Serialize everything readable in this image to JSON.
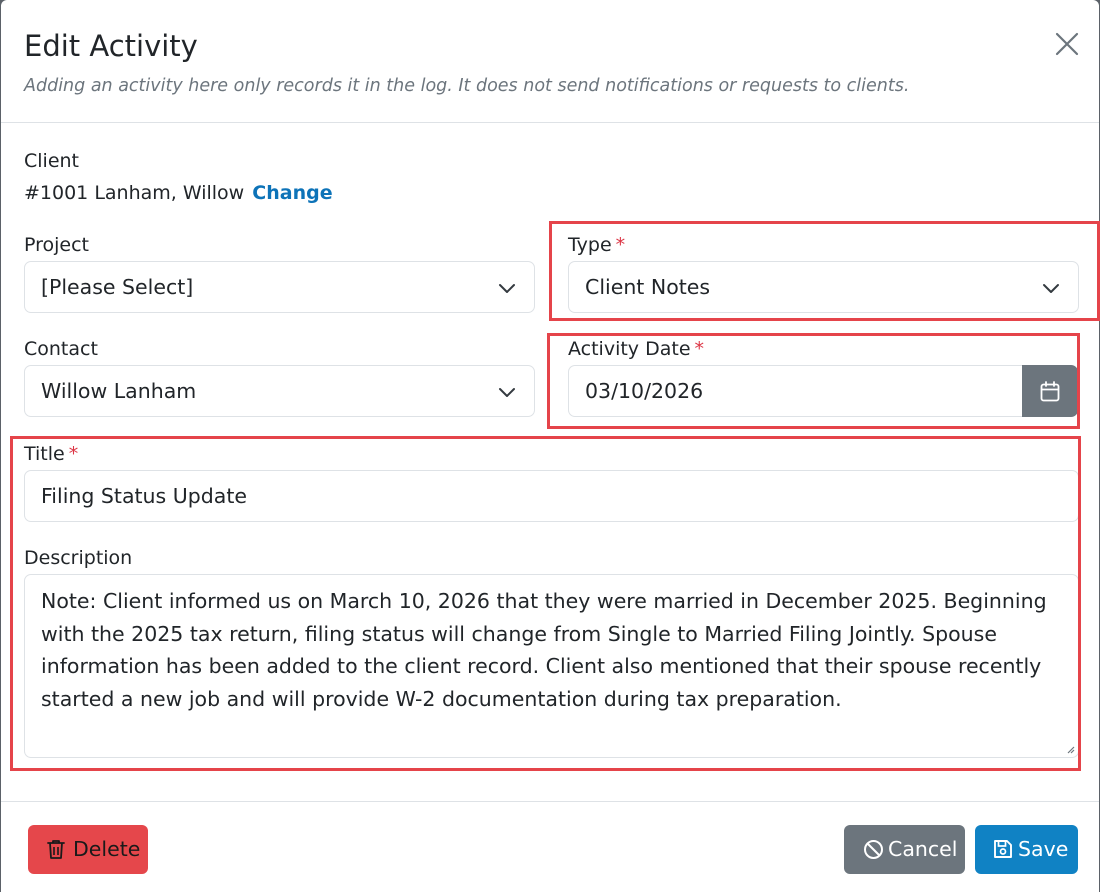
{
  "dialog": {
    "title": "Edit Activity",
    "subtitle": "Adding an activity here only records it in the log. It does not send notifications or requests to clients."
  },
  "client": {
    "label": "Client",
    "value": "#1001 Lanham, Willow",
    "change_link": "Change"
  },
  "project": {
    "label": "Project",
    "selected": "[Please Select]"
  },
  "type": {
    "label": "Type",
    "required_mark": "*",
    "selected": "Client Notes"
  },
  "contact": {
    "label": "Contact",
    "selected": "Willow Lanham"
  },
  "activity_date": {
    "label": "Activity Date",
    "required_mark": "*",
    "value": "03/10/2026"
  },
  "title_field": {
    "label": "Title",
    "required_mark": "*",
    "value": "Filing Status Update"
  },
  "description": {
    "label": "Description",
    "value": "Note: Client informed us on March 10, 2026 that they were married in December 2025. Beginning with the 2025 tax return, filing status will change from Single to Married Filing Jointly. Spouse information has been added to the client record. Client also mentioned that their spouse recently started a new job and will provide W-2 documentation during tax preparation."
  },
  "footer": {
    "delete_label": "Delete",
    "cancel_label": "Cancel",
    "save_label": "Save"
  },
  "icons": {
    "close": "close-icon",
    "chevron": "chevron-down-icon",
    "calendar": "calendar-icon",
    "trash": "trash-icon",
    "cancel": "ban-icon",
    "save": "floppy-disk-icon"
  },
  "colors": {
    "link": "#0d73b8",
    "required": "#dc3545",
    "delete": "#e5474b",
    "cancel": "#6c757d",
    "save": "#1082c4",
    "highlight": "#e5444a"
  }
}
